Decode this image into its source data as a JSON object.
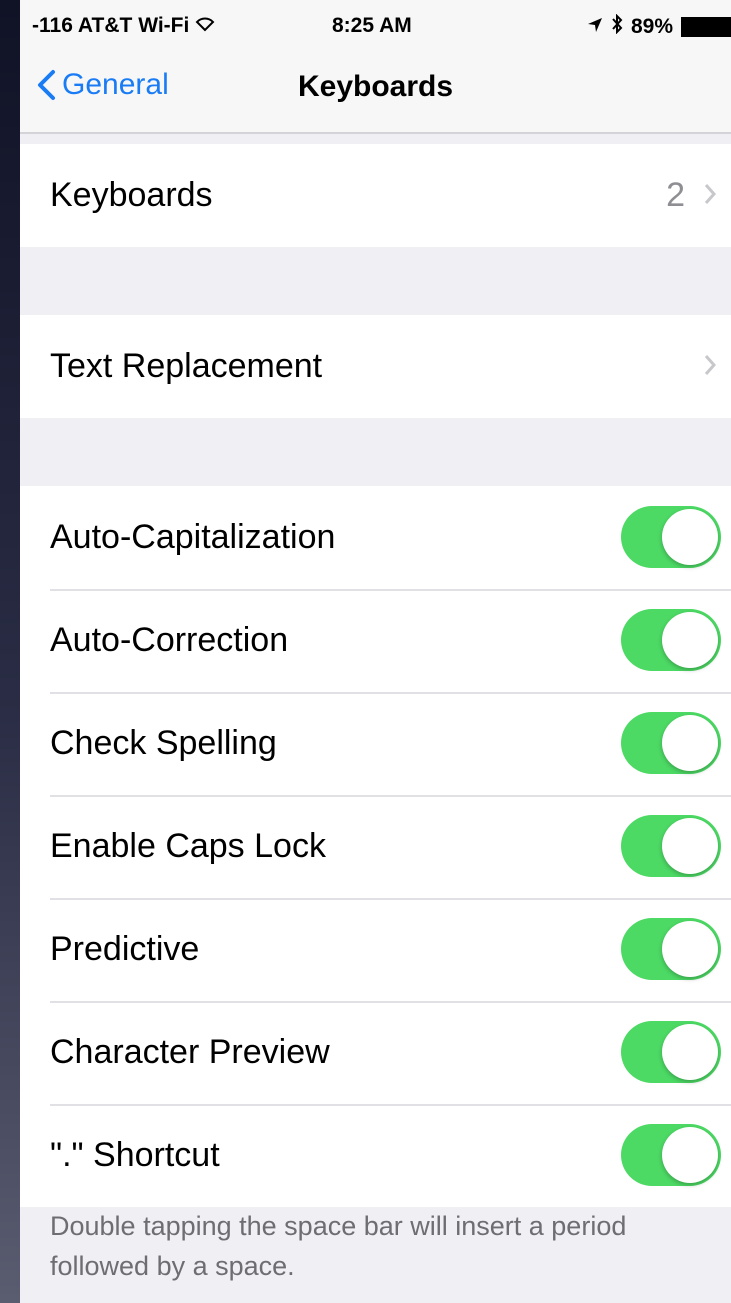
{
  "status": {
    "carrier": "-116 AT&T Wi-Fi",
    "time": "8:25 AM",
    "battery": "89%",
    "icons": [
      "wifi-icon",
      "location-icon",
      "bluetooth-icon",
      "battery-icon"
    ]
  },
  "nav": {
    "back_label": "General",
    "title": "Keyboards"
  },
  "keyboards_row": {
    "label": "Keyboards",
    "value": "2"
  },
  "text_replacement_row": {
    "label": "Text Replacement"
  },
  "toggles": [
    {
      "label": "Auto-Capitalization",
      "on": true
    },
    {
      "label": "Auto-Correction",
      "on": true
    },
    {
      "label": "Check Spelling",
      "on": true
    },
    {
      "label": "Enable Caps Lock",
      "on": true
    },
    {
      "label": "Predictive",
      "on": true
    },
    {
      "label": "Character Preview",
      "on": true
    },
    {
      "label": "\".\" Shortcut",
      "on": true
    }
  ],
  "footer_note": "Double tapping the space bar will insert a period followed by a space.",
  "colors": {
    "accent": "#1a7cf5",
    "toggle_on": "#4cd964",
    "background": "#efeff4"
  }
}
